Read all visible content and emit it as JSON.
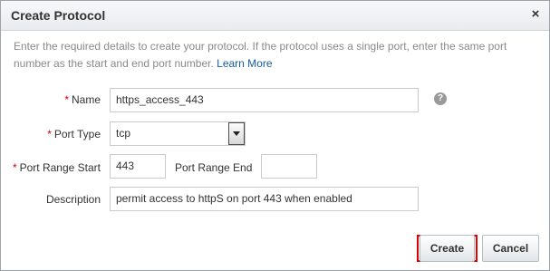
{
  "dialog": {
    "title": "Create Protocol",
    "close_label": "×",
    "intro_text": "Enter the required details to create your protocol. If the protocol uses a single port, enter the same port number as the start and end port number.",
    "learn_more_label": "Learn More"
  },
  "form": {
    "required_marker": "*",
    "name": {
      "label": "Name",
      "value": "https_access_443"
    },
    "port_type": {
      "label": "Port Type",
      "value": "tcp"
    },
    "port_range_start": {
      "label": "Port Range Start",
      "value": "443"
    },
    "port_range_end": {
      "label": "Port Range End",
      "value": ""
    },
    "description": {
      "label": "Description",
      "value": "permit access to httpS on port 443 when enabled"
    },
    "help_icon_glyph": "?"
  },
  "buttons": {
    "create_label": "Create",
    "cancel_label": "Cancel"
  },
  "colors": {
    "required": "#cc0000",
    "link": "#145c9e",
    "highlight": "#e00000"
  },
  "icons": {
    "close": "close-icon",
    "help": "help-icon",
    "dropdown": "chevron-down-icon"
  }
}
